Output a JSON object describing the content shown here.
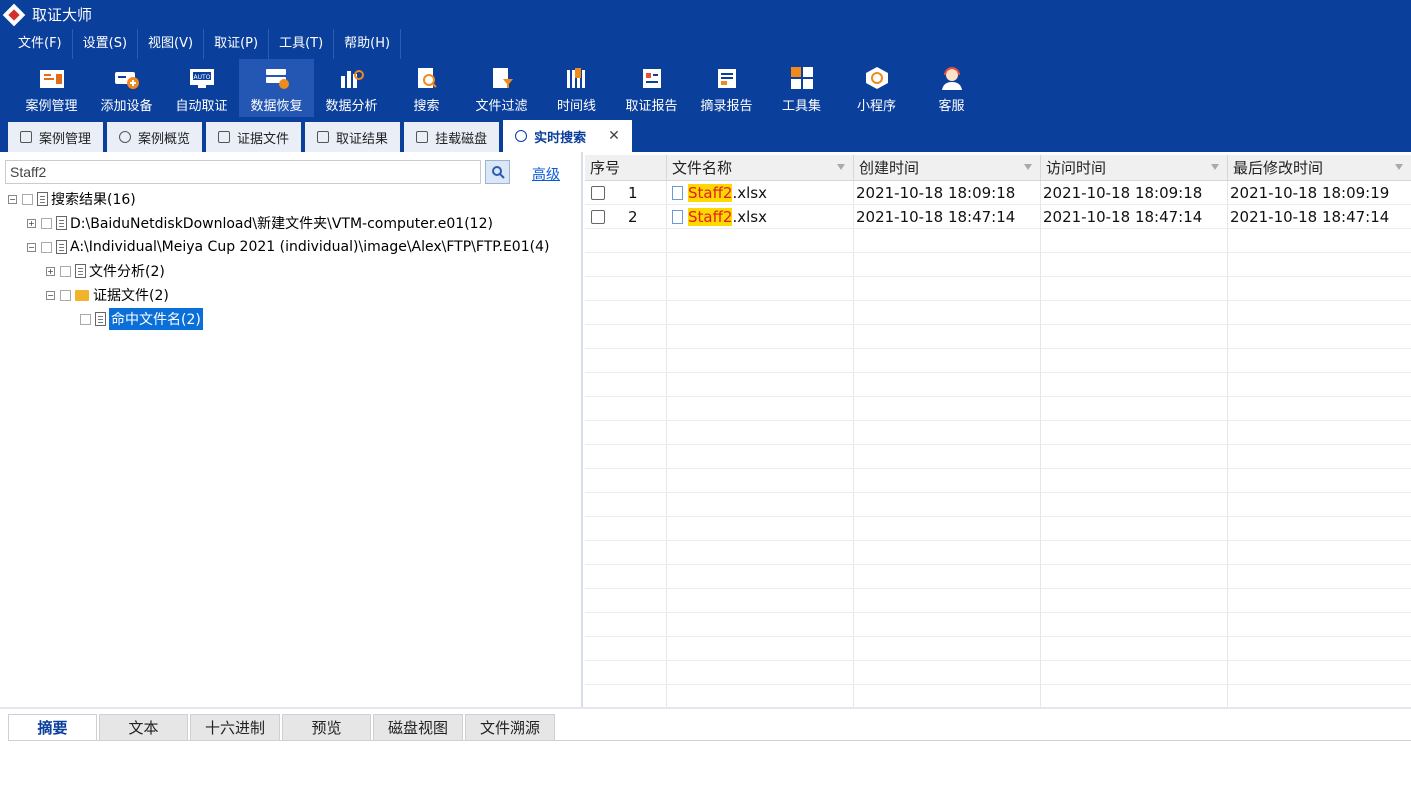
{
  "app": {
    "title": "取证大师"
  },
  "menu": [
    "文件(F)",
    "设置(S)",
    "视图(V)",
    "取证(P)",
    "工具(T)",
    "帮助(H)"
  ],
  "toolbar": [
    {
      "label": "案例管理",
      "icon": "case-folder-icon"
    },
    {
      "label": "添加设备",
      "icon": "add-device-icon"
    },
    {
      "label": "自动取证",
      "icon": "auto-monitor-icon"
    },
    {
      "label": "数据恢复",
      "icon": "data-recovery-icon"
    },
    {
      "label": "数据分析",
      "icon": "data-analysis-icon"
    },
    {
      "label": "搜索",
      "icon": "search-doc-icon"
    },
    {
      "label": "文件过滤",
      "icon": "file-filter-icon"
    },
    {
      "label": "时间线",
      "icon": "timeline-icon"
    },
    {
      "label": "取证报告",
      "icon": "report-icon"
    },
    {
      "label": "摘录报告",
      "icon": "excerpt-report-icon"
    },
    {
      "label": "工具集",
      "icon": "toolset-grid-icon"
    },
    {
      "label": "小程序",
      "icon": "mini-program-icon"
    },
    {
      "label": "客服",
      "icon": "customer-service-icon"
    }
  ],
  "tabs": [
    {
      "label": "案例管理"
    },
    {
      "label": "案例概览"
    },
    {
      "label": "证据文件"
    },
    {
      "label": "取证结果"
    },
    {
      "label": "挂载磁盘"
    },
    {
      "label": "实时搜索"
    }
  ],
  "search": {
    "value": "Staff2",
    "advanced": "高级"
  },
  "tree": {
    "root": "搜索结果(16)",
    "n1": "D:\\BaiduNetdiskDownload\\新建文件夹\\VTM-computer.e01(12)",
    "n2": "A:\\Individual\\Meiya Cup 2021 (individual)\\image\\Alex\\FTP\\FTP.E01(4)",
    "n2a": "文件分析(2)",
    "n2b": "证据文件(2)",
    "n2b1": "命中文件名(2)"
  },
  "grid": {
    "columns": [
      "序号",
      "文件名称",
      "创建时间",
      "访问时间",
      "最后修改时间"
    ],
    "rows": [
      {
        "no": "1",
        "name_hit": "Staff2",
        "name_rest": ".xlsx",
        "created": "2021-10-18 18:09:18",
        "accessed": "2021-10-18 18:09:18",
        "modified": "2021-10-18 18:09:19"
      },
      {
        "no": "2",
        "name_hit": "Staff2",
        "name_rest": ".xlsx",
        "created": "2021-10-18 18:47:14",
        "accessed": "2021-10-18 18:47:14",
        "modified": "2021-10-18 18:47:14"
      }
    ]
  },
  "bottom_tabs": [
    "摘要",
    "文本",
    "十六进制",
    "预览",
    "磁盘视图",
    "文件溯源"
  ]
}
